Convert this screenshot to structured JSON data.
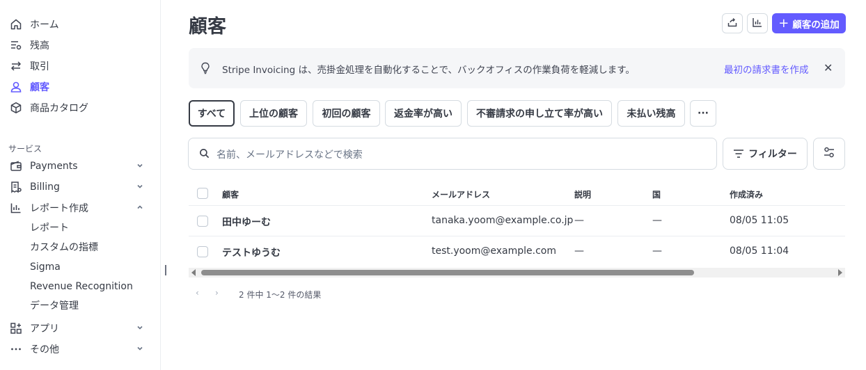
{
  "sidebar": {
    "items": [
      {
        "label": "ホーム",
        "icon": "home-icon"
      },
      {
        "label": "残高",
        "icon": "balance-icon"
      },
      {
        "label": "取引",
        "icon": "transactions-icon"
      },
      {
        "label": "顧客",
        "icon": "user-icon",
        "active": true
      },
      {
        "label": "商品カタログ",
        "icon": "cube-icon"
      }
    ],
    "section_heading": "サービス",
    "services": [
      {
        "label": "Payments",
        "icon": "wallet-icon",
        "expanded": false
      },
      {
        "label": "Billing",
        "icon": "billing-icon",
        "expanded": false
      },
      {
        "label": "レポート作成",
        "icon": "bar-chart-icon",
        "expanded": true
      }
    ],
    "report_subitems": [
      "レポート",
      "カスタムの指標",
      "Sigma",
      "Revenue Recognition",
      "データ管理"
    ],
    "more": [
      {
        "label": "アプリ",
        "icon": "apps-icon"
      },
      {
        "label": "その他",
        "icon": "more-dots-icon"
      }
    ]
  },
  "header": {
    "title": "顧客",
    "add_button_label": "顧客の追加",
    "export_icon": "export-icon",
    "analytics_icon": "bar-chart-icon"
  },
  "banner": {
    "message": "Stripe Invoicing は、売掛金処理を自動化することで、バックオフィスの作業負荷を軽減します。",
    "link": "最初の請求書を作成",
    "icon": "lightbulb-icon"
  },
  "filters": {
    "chips": [
      "すべて",
      "上位の顧客",
      "初回の顧客",
      "返金率が高い",
      "不審請求の申し立て率が高い",
      "未払い残高",
      "···"
    ],
    "selected": "すべて"
  },
  "search": {
    "placeholder": "名前、メールアドレスなどで検索"
  },
  "filter_button": "フィルター",
  "table": {
    "columns": [
      "顧客",
      "メールアドレス",
      "説明",
      "国",
      "作成済み"
    ],
    "rows": [
      {
        "name": "田中ゆーむ",
        "email": "tanaka.yoom@example.co.jp",
        "description": "—",
        "country": "—",
        "created": "08/05 11:05"
      },
      {
        "name": "テストゆうむ",
        "email": "test.yoom@example.com",
        "description": "—",
        "country": "—",
        "created": "08/05 11:04"
      }
    ]
  },
  "pagination": {
    "prev": "‹",
    "next": "›",
    "result_text": "2 件中 1〜2 件の結果"
  },
  "colors": {
    "accent": "#635bff",
    "text": "#353a44",
    "border": "#d5dbe1",
    "banner_bg": "#f5f6f8"
  }
}
